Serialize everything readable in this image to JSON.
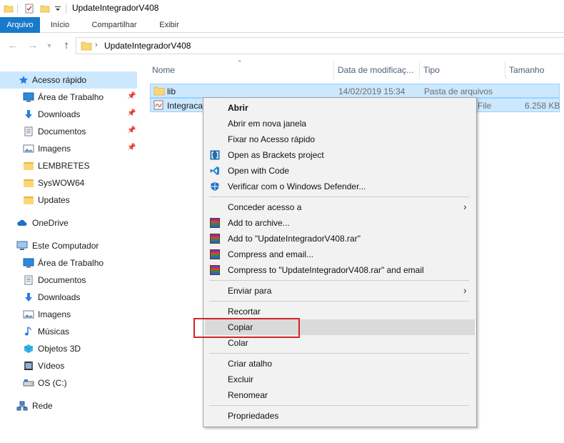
{
  "window": {
    "title": "UpdateIntegradorV408"
  },
  "ribbon": {
    "tabs": [
      "Arquivo",
      "Início",
      "Compartilhar",
      "Exibir"
    ]
  },
  "addressbar": {
    "path": "UpdateIntegradorV408"
  },
  "navigation": {
    "items": [
      {
        "label": "Acesso rápido",
        "icon": "star-icon",
        "pinned": false
      },
      {
        "label": "Área de Trabalho",
        "icon": "desktop-icon",
        "pinned": true
      },
      {
        "label": "Downloads",
        "icon": "download-icon",
        "pinned": true
      },
      {
        "label": "Documentos",
        "icon": "document-icon",
        "pinned": true
      },
      {
        "label": "Imagens",
        "icon": "image-icon",
        "pinned": true
      },
      {
        "label": "LEMBRETES",
        "icon": "folder-icon",
        "pinned": false
      },
      {
        "label": "SysWOW64",
        "icon": "folder-icon",
        "pinned": false
      },
      {
        "label": "Updates",
        "icon": "folder-icon",
        "pinned": false
      },
      {
        "label": "OneDrive",
        "icon": "cloud-icon",
        "pinned": false
      },
      {
        "label": "Este Computador",
        "icon": "computer-icon",
        "pinned": false
      },
      {
        "label": "Área de Trabalho",
        "icon": "desktop-icon",
        "pinned": false
      },
      {
        "label": "Documentos",
        "icon": "document-icon",
        "pinned": false
      },
      {
        "label": "Downloads",
        "icon": "download-icon",
        "pinned": false
      },
      {
        "label": "Imagens",
        "icon": "image-icon",
        "pinned": false
      },
      {
        "label": "Músicas",
        "icon": "music-icon",
        "pinned": false
      },
      {
        "label": "Objetos 3D",
        "icon": "cube-icon",
        "pinned": false
      },
      {
        "label": "Vídeos",
        "icon": "video-icon",
        "pinned": false
      },
      {
        "label": "OS (C:)",
        "icon": "drive-icon",
        "pinned": false
      },
      {
        "label": "Rede",
        "icon": "network-icon",
        "pinned": false
      }
    ]
  },
  "filelist": {
    "columns": [
      "Nome",
      "Data de modificaç...",
      "Tipo",
      "Tamanho"
    ],
    "rows": [
      {
        "name": "lib",
        "modified": "14/02/2019 15:34",
        "type": "Pasta de arquivos",
        "size": ""
      },
      {
        "name": "Integraca",
        "modified": "",
        "type": "File",
        "size": "6.258 KB"
      }
    ]
  },
  "context_menu": {
    "items": [
      "Abrir",
      "Abrir em nova janela",
      "Fixar no Acesso rápido",
      "Open as Brackets project",
      "Open with Code",
      "Verificar com o Windows Defender...",
      "Conceder acesso a",
      "Add to archive...",
      "Add to \"UpdateIntegradorV408.rar\"",
      "Compress and email...",
      "Compress to \"UpdateIntegradorV408.rar\" and email",
      "Enviar para",
      "Recortar",
      "Copiar",
      "Colar",
      "Criar atalho",
      "Excluir",
      "Renomear",
      "Propriedades"
    ],
    "hovered": "Copiar"
  },
  "colors": {
    "accent": "#1979ca",
    "selection": "#cce8ff",
    "highlight_box": "#d4242a"
  }
}
